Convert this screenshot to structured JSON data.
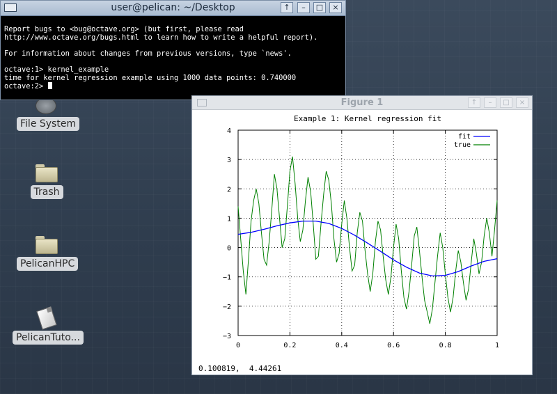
{
  "desktop": {
    "icons": [
      {
        "label": "File System",
        "icon": "disk-icon"
      },
      {
        "label": "Trash",
        "icon": "folder-icon"
      },
      {
        "label": "PelicanHPC",
        "icon": "folder-icon"
      },
      {
        "label": "PelicanTuto...",
        "icon": "document-icon"
      }
    ]
  },
  "terminal": {
    "title": "user@pelican: ~/Desktop",
    "lines": [
      "Report bugs to <bug@octave.org> (but first, please read",
      "http://www.octave.org/bugs.html to learn how to write a helpful report).",
      "",
      "For information about changes from previous versions, type `news'.",
      "",
      "octave:1> kernel_example",
      "time for kernel regression example using 1000 data points: 0.740000"
    ],
    "prompt": "octave:2> ",
    "buttons": {
      "up": "↑",
      "minimize": "–",
      "maximize": "□",
      "close": "×"
    }
  },
  "figure": {
    "title": "Figure 1",
    "coordinate_readout": "0.100819,  4.44261",
    "buttons": {
      "up": "↑",
      "minimize": "–",
      "maximize": "□",
      "close": "×"
    }
  },
  "colors": {
    "fit": "#0000ff",
    "true": "#008000"
  },
  "chart_data": {
    "type": "line",
    "title": "Example 1: Kernel regression fit",
    "xlabel": "",
    "ylabel": "",
    "xlim": [
      0,
      1
    ],
    "ylim": [
      -3,
      4
    ],
    "x_ticks": [
      "0",
      "0.2",
      "0.4",
      "0.6",
      "0.8",
      "1"
    ],
    "y_ticks": [
      "4",
      "3",
      "2",
      "1",
      "0",
      "−1",
      "−2",
      "−3"
    ],
    "grid": true,
    "legend_position": "top-right",
    "series": [
      {
        "name": "fit",
        "x": [
          0,
          0.05,
          0.1,
          0.15,
          0.2,
          0.25,
          0.3,
          0.35,
          0.4,
          0.45,
          0.5,
          0.55,
          0.6,
          0.65,
          0.7,
          0.75,
          0.8,
          0.85,
          0.9,
          0.95,
          1.0
        ],
        "values": [
          0.45,
          0.52,
          0.62,
          0.74,
          0.84,
          0.9,
          0.9,
          0.82,
          0.65,
          0.42,
          0.15,
          -0.13,
          -0.42,
          -0.67,
          -0.87,
          -0.97,
          -0.95,
          -0.82,
          -0.63,
          -0.47,
          -0.38
        ]
      },
      {
        "name": "true",
        "x": [
          0,
          0.01,
          0.02,
          0.03,
          0.04,
          0.05,
          0.06,
          0.07,
          0.08,
          0.09,
          0.1,
          0.11,
          0.12,
          0.13,
          0.14,
          0.15,
          0.16,
          0.17,
          0.18,
          0.19,
          0.2,
          0.21,
          0.22,
          0.23,
          0.24,
          0.25,
          0.26,
          0.27,
          0.28,
          0.29,
          0.3,
          0.31,
          0.32,
          0.33,
          0.34,
          0.35,
          0.36,
          0.37,
          0.38,
          0.39,
          0.4,
          0.41,
          0.42,
          0.43,
          0.44,
          0.45,
          0.46,
          0.47,
          0.48,
          0.49,
          0.5,
          0.51,
          0.52,
          0.53,
          0.54,
          0.55,
          0.56,
          0.57,
          0.58,
          0.59,
          0.6,
          0.61,
          0.62,
          0.63,
          0.64,
          0.65,
          0.66,
          0.67,
          0.68,
          0.69,
          0.7,
          0.71,
          0.72,
          0.73,
          0.74,
          0.75,
          0.76,
          0.77,
          0.78,
          0.79,
          0.8,
          0.81,
          0.82,
          0.83,
          0.84,
          0.85,
          0.86,
          0.87,
          0.88,
          0.89,
          0.9,
          0.91,
          0.92,
          0.93,
          0.94,
          0.95,
          0.96,
          0.97,
          0.98,
          0.99,
          1.0
        ],
        "values": [
          1.4,
          0.3,
          -0.8,
          -1.6,
          -0.4,
          0.9,
          1.6,
          2.0,
          1.5,
          0.5,
          -0.4,
          -0.6,
          0.2,
          1.3,
          2.5,
          2.0,
          1.0,
          0.0,
          0.3,
          1.4,
          2.6,
          3.1,
          2.2,
          1.0,
          0.2,
          0.6,
          1.6,
          2.4,
          1.9,
          0.8,
          -0.4,
          -0.3,
          0.8,
          1.8,
          2.6,
          2.3,
          1.5,
          0.3,
          -0.5,
          -0.2,
          0.8,
          1.6,
          1.0,
          0.0,
          -0.8,
          -0.6,
          0.5,
          1.2,
          0.9,
          -0.1,
          -0.9,
          -1.5,
          -0.9,
          0.2,
          0.9,
          0.6,
          -0.3,
          -1.1,
          -1.6,
          -1.0,
          0.0,
          0.8,
          0.3,
          -0.8,
          -1.7,
          -2.1,
          -1.5,
          -0.6,
          0.4,
          0.7,
          -0.1,
          -1.0,
          -1.8,
          -2.2,
          -2.6,
          -2.1,
          -1.2,
          -0.3,
          0.5,
          0.0,
          -0.9,
          -1.7,
          -2.2,
          -1.7,
          -0.8,
          -0.1,
          -0.5,
          -1.2,
          -1.8,
          -1.4,
          -0.5,
          0.3,
          -0.2,
          -0.9,
          -0.5,
          0.4,
          1.0,
          0.5,
          -0.3,
          0.6,
          1.6
        ]
      }
    ]
  }
}
